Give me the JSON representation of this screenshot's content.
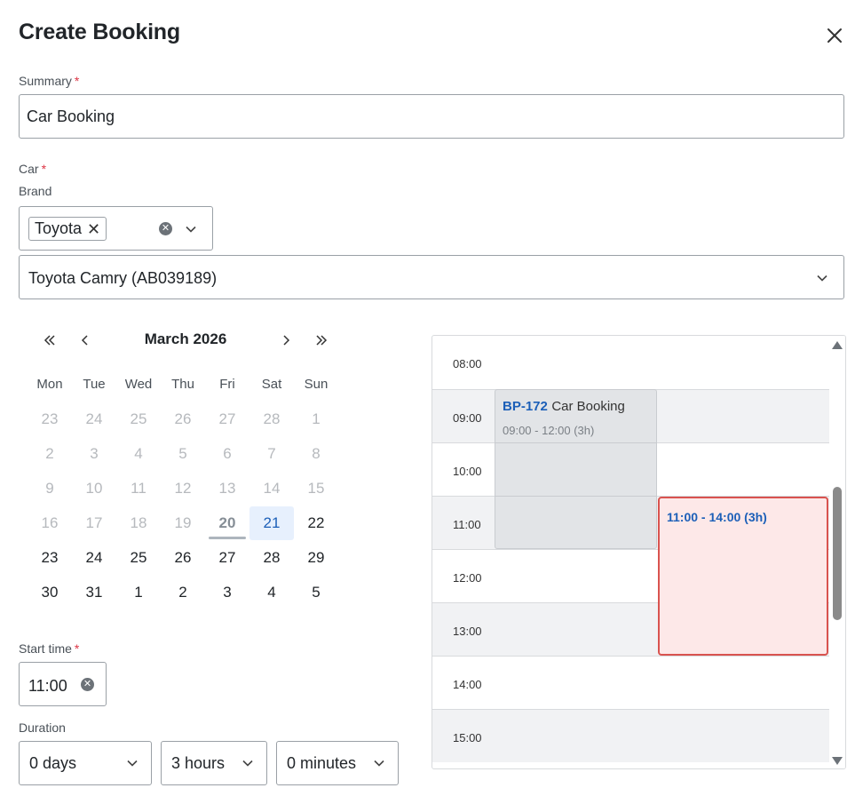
{
  "dialog": {
    "title": "Create Booking"
  },
  "summary": {
    "label": "Summary",
    "required_mark": "*",
    "value": "Car Booking"
  },
  "car": {
    "label": "Car",
    "required_mark": "*",
    "brand_label": "Brand",
    "brand_chip": "Toyota",
    "model_value": "Toyota Camry (AB039189)"
  },
  "calendar": {
    "month_label": "March 2026",
    "weekdays": [
      "Mon",
      "Tue",
      "Wed",
      "Thu",
      "Fri",
      "Sat",
      "Sun"
    ],
    "weeks": [
      [
        "23",
        "24",
        "25",
        "26",
        "27",
        "28",
        "1"
      ],
      [
        "2",
        "3",
        "4",
        "5",
        "6",
        "7",
        "8"
      ],
      [
        "9",
        "10",
        "11",
        "12",
        "13",
        "14",
        "15"
      ],
      [
        "16",
        "17",
        "18",
        "19",
        "20",
        "21",
        "22"
      ],
      [
        "23",
        "24",
        "25",
        "26",
        "27",
        "28",
        "29"
      ],
      [
        "30",
        "31",
        "1",
        "2",
        "3",
        "4",
        "5"
      ]
    ],
    "today": "20",
    "selected": "21"
  },
  "start_time": {
    "label": "Start time",
    "required_mark": "*",
    "value": "11:00"
  },
  "duration": {
    "label": "Duration",
    "days": "0 days",
    "hours": "3 hours",
    "minutes": "0 minutes"
  },
  "schedule": {
    "times": [
      "08:00",
      "09:00",
      "10:00",
      "11:00",
      "12:00",
      "13:00",
      "14:00",
      "15:00"
    ],
    "existing_event": {
      "id": "BP-172",
      "name": "Car Booking",
      "time": "09:00 - 12:00 (3h)"
    },
    "new_event": {
      "time": "11:00 - 14:00 (3h)"
    }
  }
}
